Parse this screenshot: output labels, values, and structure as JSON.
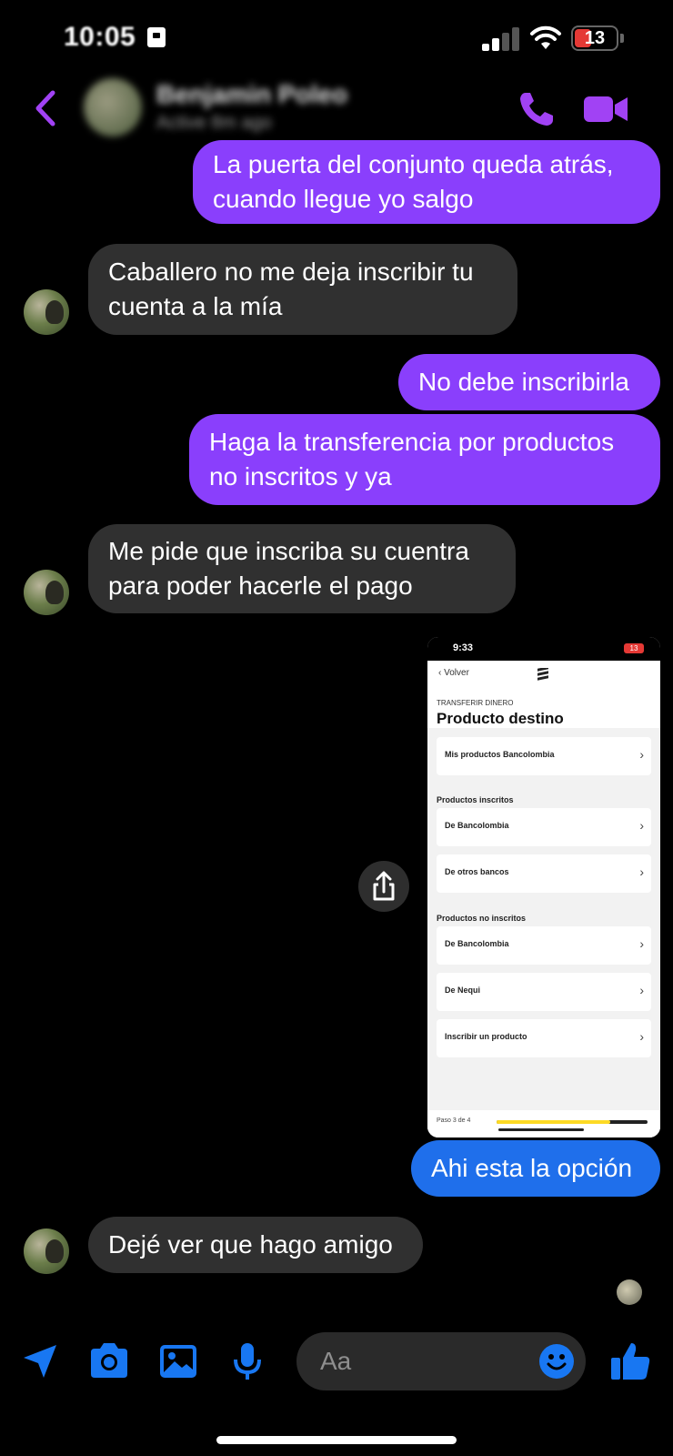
{
  "status": {
    "time": "10:05",
    "battery": "13"
  },
  "header": {
    "contact_name": "Benjamin Poleo",
    "contact_status": "Active 8m ago"
  },
  "messages": [
    {
      "from": "me",
      "text": "La puerta del conjunto queda atrás, cuando llegue yo salgo"
    },
    {
      "from": "them",
      "text": "Caballero no me deja inscribir tu cuenta a la mía"
    },
    {
      "from": "me",
      "text": "No debe inscribirla"
    },
    {
      "from": "me",
      "text": "Haga la transferencia por productos no inscritos y ya"
    },
    {
      "from": "them",
      "text": "Me pide que inscriba su cuentra para poder hacerle el pago"
    },
    {
      "from": "me",
      "text": "Ahi esta la opción"
    },
    {
      "from": "them",
      "text": "Dejé ver que hago amigo"
    }
  ],
  "shared_screenshot": {
    "time": "9:33",
    "battery": "13",
    "back_label": "Volver",
    "kicker": "TRANSFERIR DINERO",
    "title": "Producto destino",
    "row_mis_productos": "Mis productos Bancolombia",
    "section_inscritos": "Productos inscritos",
    "row_inscritos_bancolombia": "De Bancolombia",
    "row_otros_bancos": "De otros bancos",
    "section_no_inscritos": "Productos no inscritos",
    "row_no_inscritos_bancolombia": "De Bancolombia",
    "row_nequi": "De Nequi",
    "row_inscribir": "Inscribir un producto",
    "step": "Paso 3 de 4",
    "progress": 0.75,
    "progress_color": "#fdda24"
  },
  "composer": {
    "placeholder": "Aa"
  },
  "colors": {
    "outgoing": "#8a3ffc",
    "incoming": "#303030",
    "sent_blue": "#1f6feb",
    "accent_icons": "#1877f2",
    "header_icons": "#a142f4"
  }
}
